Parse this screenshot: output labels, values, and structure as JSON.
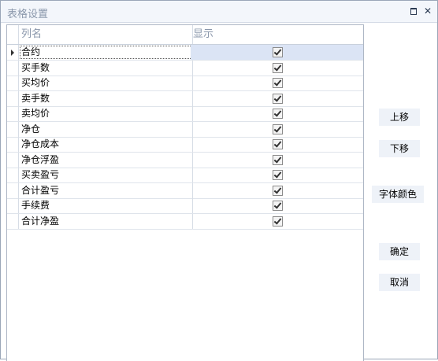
{
  "window": {
    "title": "表格设置"
  },
  "grid": {
    "columns": [
      "列名",
      "显示"
    ],
    "rows": [
      {
        "name": "合约",
        "show": true,
        "selected": true
      },
      {
        "name": "买手数",
        "show": true
      },
      {
        "name": "买均价",
        "show": true
      },
      {
        "name": "卖手数",
        "show": true
      },
      {
        "name": "卖均价",
        "show": true
      },
      {
        "name": "净仓",
        "show": true
      },
      {
        "name": "净仓成本",
        "show": true
      },
      {
        "name": "净仓浮盈",
        "show": true
      },
      {
        "name": "买卖盈亏",
        "show": true
      },
      {
        "name": "合计盈亏",
        "show": true
      },
      {
        "name": "手续费",
        "show": true
      },
      {
        "name": "合计净盈",
        "show": true
      }
    ]
  },
  "buttons": {
    "up": "上移",
    "down": "下移",
    "font_color": "字体颜色",
    "ok": "确定",
    "cancel": "取消"
  },
  "icons": {
    "restore": "restore-icon",
    "close": "close-icon"
  }
}
